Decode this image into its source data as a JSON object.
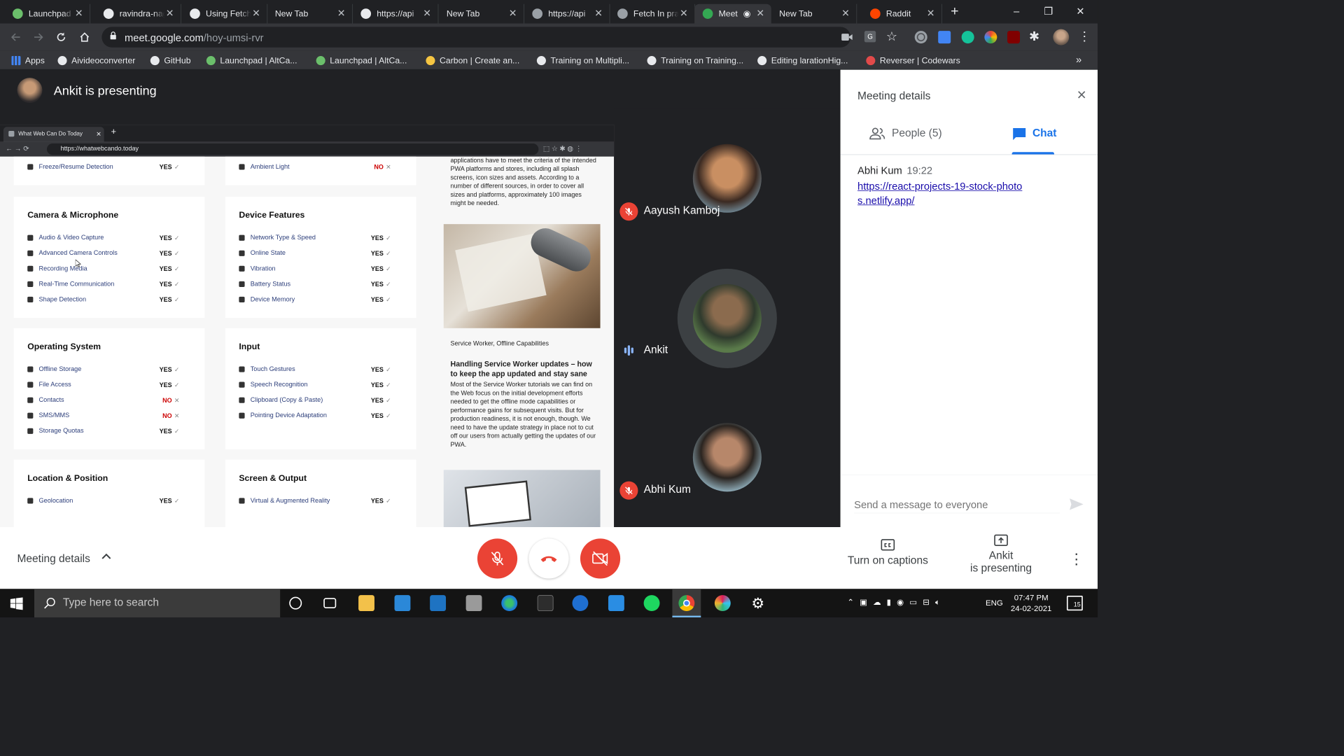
{
  "browser": {
    "tabs": [
      {
        "title": "Launchpad | AltCampus",
        "color": "#6bbf6b"
      },
      {
        "title": "ravindra-nagar",
        "color": "#e8eaed"
      },
      {
        "title": "Using Fetch",
        "color": "#e8eaed"
      },
      {
        "title": "New Tab",
        "color": ""
      },
      {
        "title": "https://api",
        "color": "#e8eaed"
      },
      {
        "title": "New Tab",
        "color": ""
      },
      {
        "title": "https://api",
        "color": "#9aa0a6"
      },
      {
        "title": "Fetch In practice",
        "color": "#9aa0a6"
      },
      {
        "title": "Meet",
        "color": "#34a853"
      },
      {
        "title": "New Tab",
        "color": ""
      },
      {
        "title": "Raddit",
        "color": "#ff4500"
      }
    ],
    "new_tab": "+",
    "window_controls": {
      "minimize": "–",
      "restore": "❐",
      "close": "✕"
    },
    "url_host": "meet.google.com",
    "url_path": "/hoy-umsi-rvr",
    "bookmarks": [
      "Apps",
      "Aivideoconverter",
      "GitHub",
      "Launchpad | AltCa...",
      "Launchpad | AltCa...",
      "Carbon | Create an...",
      "Training on Multipli...",
      "Training on Training...",
      "Editing larationHig...",
      "Reverser | Codewars"
    ],
    "bookmark_more": "»"
  },
  "meet": {
    "presenting_title": "Ankit is presenting",
    "shared_screen": {
      "tab_title": "What Web Can Do Today",
      "tab_plus": "+",
      "url": "https://whatwebcando.today",
      "top_rows": [
        {
          "label": "Freeze/Resume Detection",
          "value": "YES",
          "mark": "✓"
        },
        {
          "label": "Ambient Light",
          "value": "NO",
          "mark": "✕"
        }
      ],
      "sections": [
        {
          "title": "Camera & Microphone",
          "rows": [
            {
              "label": "Audio & Video Capture",
              "value": "YES",
              "mark": "✓"
            },
            {
              "label": "Advanced Camera Controls",
              "value": "YES",
              "mark": "✓"
            },
            {
              "label": "Recording Media",
              "value": "YES",
              "mark": "✓"
            },
            {
              "label": "Real-Time Communication",
              "value": "YES",
              "mark": "✓"
            },
            {
              "label": "Shape Detection",
              "value": "YES",
              "mark": "✓"
            }
          ]
        },
        {
          "title": "Device Features",
          "rows": [
            {
              "label": "Network Type & Speed",
              "value": "YES",
              "mark": "✓"
            },
            {
              "label": "Online State",
              "value": "YES",
              "mark": "✓"
            },
            {
              "label": "Vibration",
              "value": "YES",
              "mark": "✓"
            },
            {
              "label": "Battery Status",
              "value": "YES",
              "mark": "✓"
            },
            {
              "label": "Device Memory",
              "value": "YES",
              "mark": "✓"
            }
          ]
        },
        {
          "title": "Operating System",
          "rows": [
            {
              "label": "Offline Storage",
              "value": "YES",
              "mark": "✓"
            },
            {
              "label": "File Access",
              "value": "YES",
              "mark": "✓"
            },
            {
              "label": "Contacts",
              "value": "NO",
              "mark": "✕"
            },
            {
              "label": "SMS/MMS",
              "value": "NO",
              "mark": "✕"
            },
            {
              "label": "Storage Quotas",
              "value": "YES",
              "mark": "✓"
            }
          ]
        },
        {
          "title": "Input",
          "rows": [
            {
              "label": "Touch Gestures",
              "value": "YES",
              "mark": "✓"
            },
            {
              "label": "Speech Recognition",
              "value": "YES",
              "mark": "✓"
            },
            {
              "label": "Clipboard (Copy & Paste)",
              "value": "YES",
              "mark": "✓"
            },
            {
              "label": "Pointing Device Adaptation",
              "value": "YES",
              "mark": "✓"
            }
          ]
        },
        {
          "title": "Location & Position",
          "rows": [
            {
              "label": "Geolocation",
              "value": "YES",
              "mark": "✓"
            }
          ]
        },
        {
          "title": "Screen & Output",
          "rows": [
            {
              "label": "Virtual & Augmented Reality",
              "value": "YES",
              "mark": "✓"
            }
          ]
        }
      ],
      "blog": {
        "intro": "applications have to meet the criteria of the intended PWA platforms and stores, including all splash screens, icon sizes and assets. According to a number of different sources, in order to cover all sizes and platforms, approximately 100 images might be needed.",
        "caption": "Service Worker, Offline Capabilities",
        "headline": "Handling Service Worker updates – how to keep the app updated and stay sane",
        "body": "Most of the Service Worker tutorials we can find on the Web focus on the initial development efforts needed to get the offline mode capabilities or performance gains for subsequent visits. But for production readiness, it is not enough, though. We need to have the update strategy in place not to cut off our users from actually getting the updates of our PWA."
      }
    },
    "participants": [
      {
        "name": "Aayush Kamboj",
        "muted": true
      },
      {
        "name": "Ankit",
        "muted": false
      },
      {
        "name": "Abhi Kum",
        "muted": true
      }
    ],
    "panel": {
      "title": "Meeting details",
      "people_tab": "People (5)",
      "chat_tab": "Chat",
      "message": {
        "sender": "Abhi Kum",
        "time": "19:22",
        "text": "https://react-projects-19-stock-photos.netlify.app/"
      },
      "composer_placeholder": "Send a message to everyone"
    },
    "bottom": {
      "meeting_details": "Meeting details",
      "captions": "Turn on captions",
      "presenting_line1": "Ankit",
      "presenting_line2": "is presenting",
      "more": "⋮"
    }
  },
  "taskbar": {
    "search_placeholder": "Type here to search",
    "language": "ENG",
    "time": "07:47 PM",
    "date": "24-02-2021",
    "notification_count": "15"
  },
  "colors": {
    "accent": "#1a73e8",
    "danger": "#ea4335",
    "speaking": "#8ab4f8"
  }
}
